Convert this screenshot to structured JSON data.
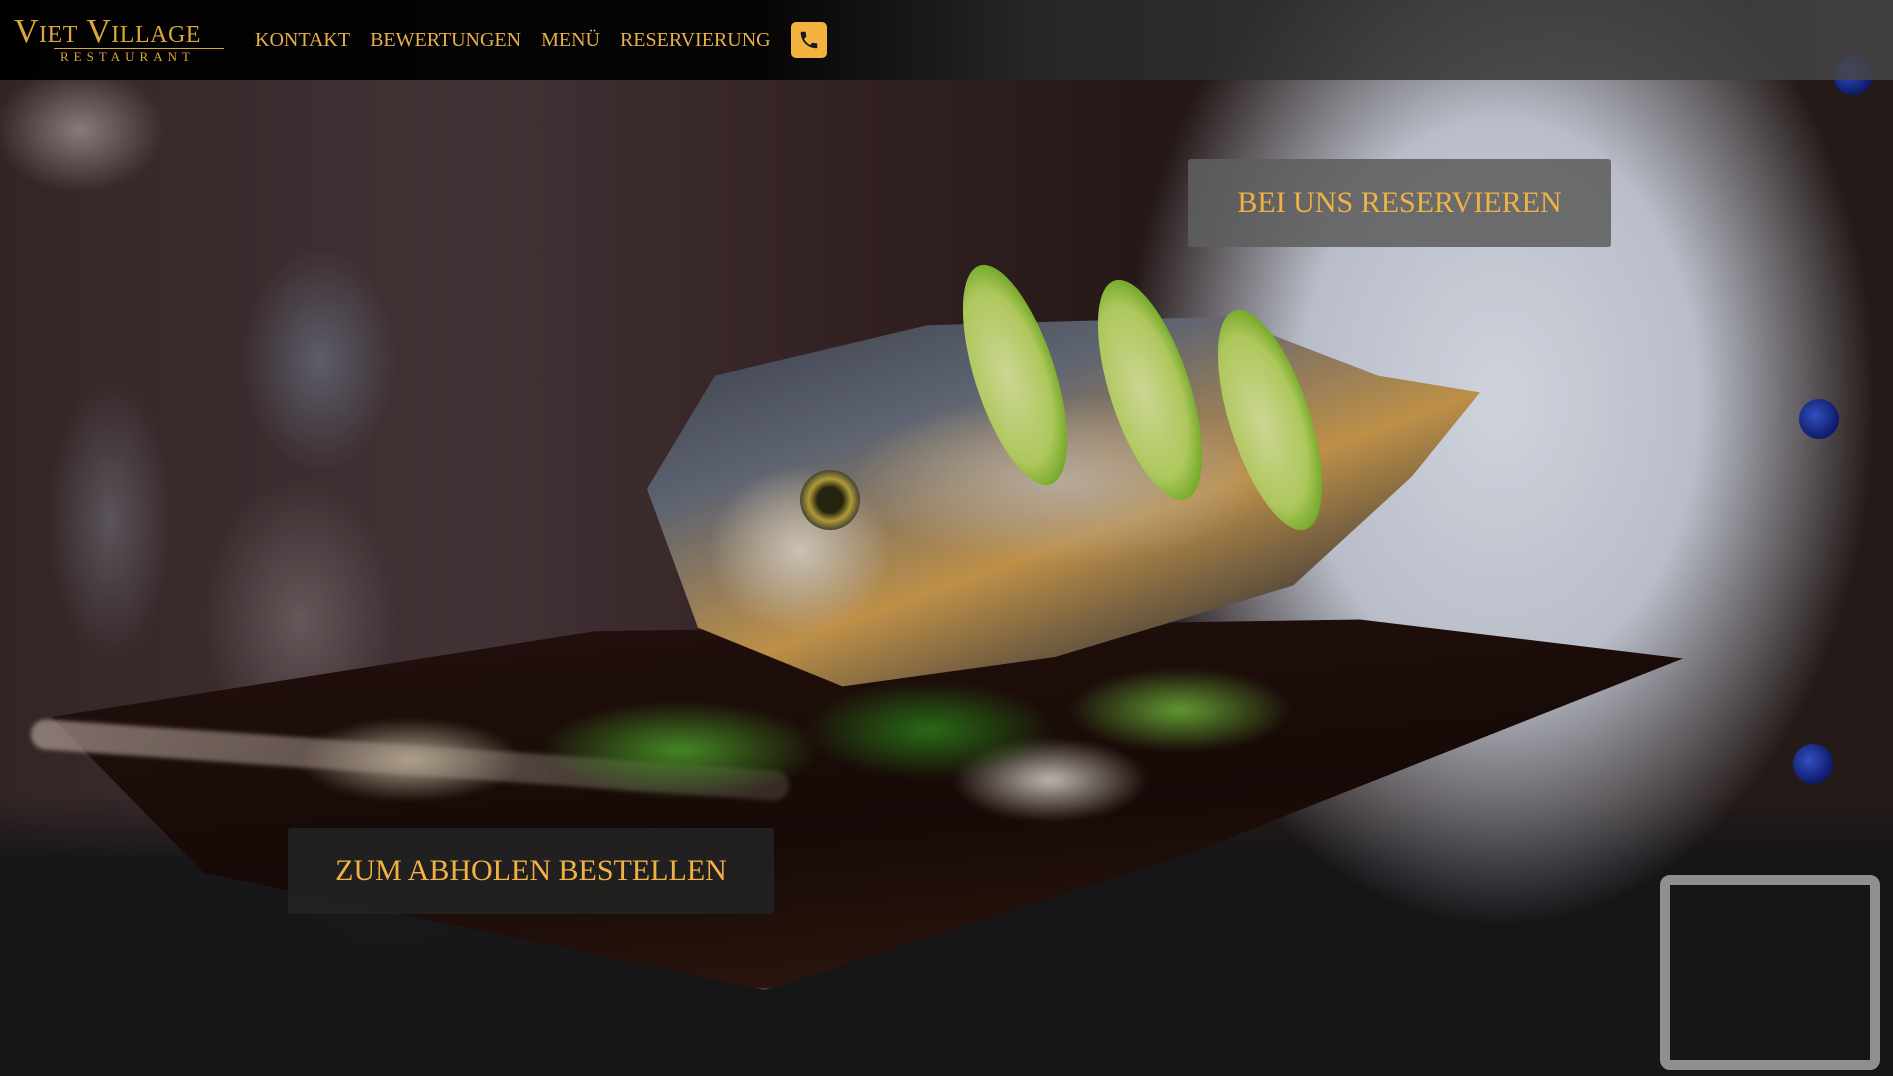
{
  "brand": {
    "name_line1": "Viet Village",
    "name_line2": "RESTAURANT",
    "color": "#d9a73a"
  },
  "nav": {
    "items": [
      {
        "label": "KONTAKT"
      },
      {
        "label": "BEWERTUNGEN"
      },
      {
        "label": "MENÜ"
      },
      {
        "label": "RESERVIERUNG"
      }
    ],
    "phone_icon": "phone-icon",
    "accent": "#f4b23e"
  },
  "hero": {
    "reserve_label": "BEI UNS RESERVIEREN",
    "pickup_label": "ZUM ABHOLEN BESTELLEN",
    "background_icon": "hero-photo-fish-dish"
  }
}
